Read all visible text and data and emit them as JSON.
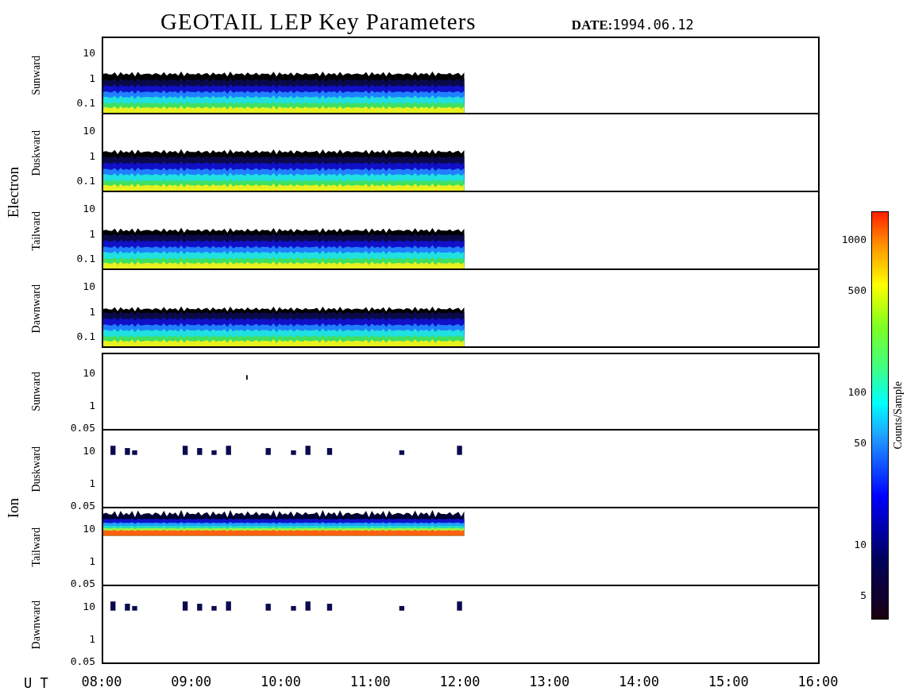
{
  "title": "GEOTAIL LEP Key Parameters",
  "date": {
    "label": "DATE:",
    "value": "1994.06.12"
  },
  "groups": [
    {
      "name": "Electron",
      "panels": [
        {
          "label": "Sunward",
          "kind": "electron-band",
          "yticks": [
            "10",
            "1",
            "0.1"
          ]
        },
        {
          "label": "Duskward",
          "kind": "electron-band",
          "yticks": [
            "10",
            "1",
            "0.1"
          ]
        },
        {
          "label": "Tailward",
          "kind": "electron-band",
          "yticks": [
            "10",
            "1",
            "0.1"
          ]
        },
        {
          "label": "Dawnward",
          "kind": "electron-band",
          "yticks": [
            "10",
            "1",
            "0.1"
          ]
        }
      ]
    },
    {
      "name": "Ion",
      "panels": [
        {
          "label": "Sunward",
          "kind": "empty",
          "yticks": [
            "10",
            "1",
            "0.05"
          ]
        },
        {
          "label": "Duskward",
          "kind": "sparse",
          "yticks": [
            "10",
            "1",
            "0.05"
          ]
        },
        {
          "label": "Tailward",
          "kind": "ion-band",
          "yticks": [
            "10",
            "1",
            "0.05"
          ]
        },
        {
          "label": "Dawnward",
          "kind": "sparse",
          "yticks": [
            "10",
            "1",
            "0.05"
          ]
        }
      ]
    }
  ],
  "colorbar": {
    "label": "Counts/Sample",
    "ticks": [
      "1000",
      "500",
      "100",
      "50",
      "10",
      "5"
    ]
  },
  "xaxis": {
    "label": "U T",
    "ticks": [
      "08:00",
      "09:00",
      "10:00",
      "11:00",
      "12:00",
      "13:00",
      "14:00",
      "15:00",
      "16:00"
    ]
  }
}
